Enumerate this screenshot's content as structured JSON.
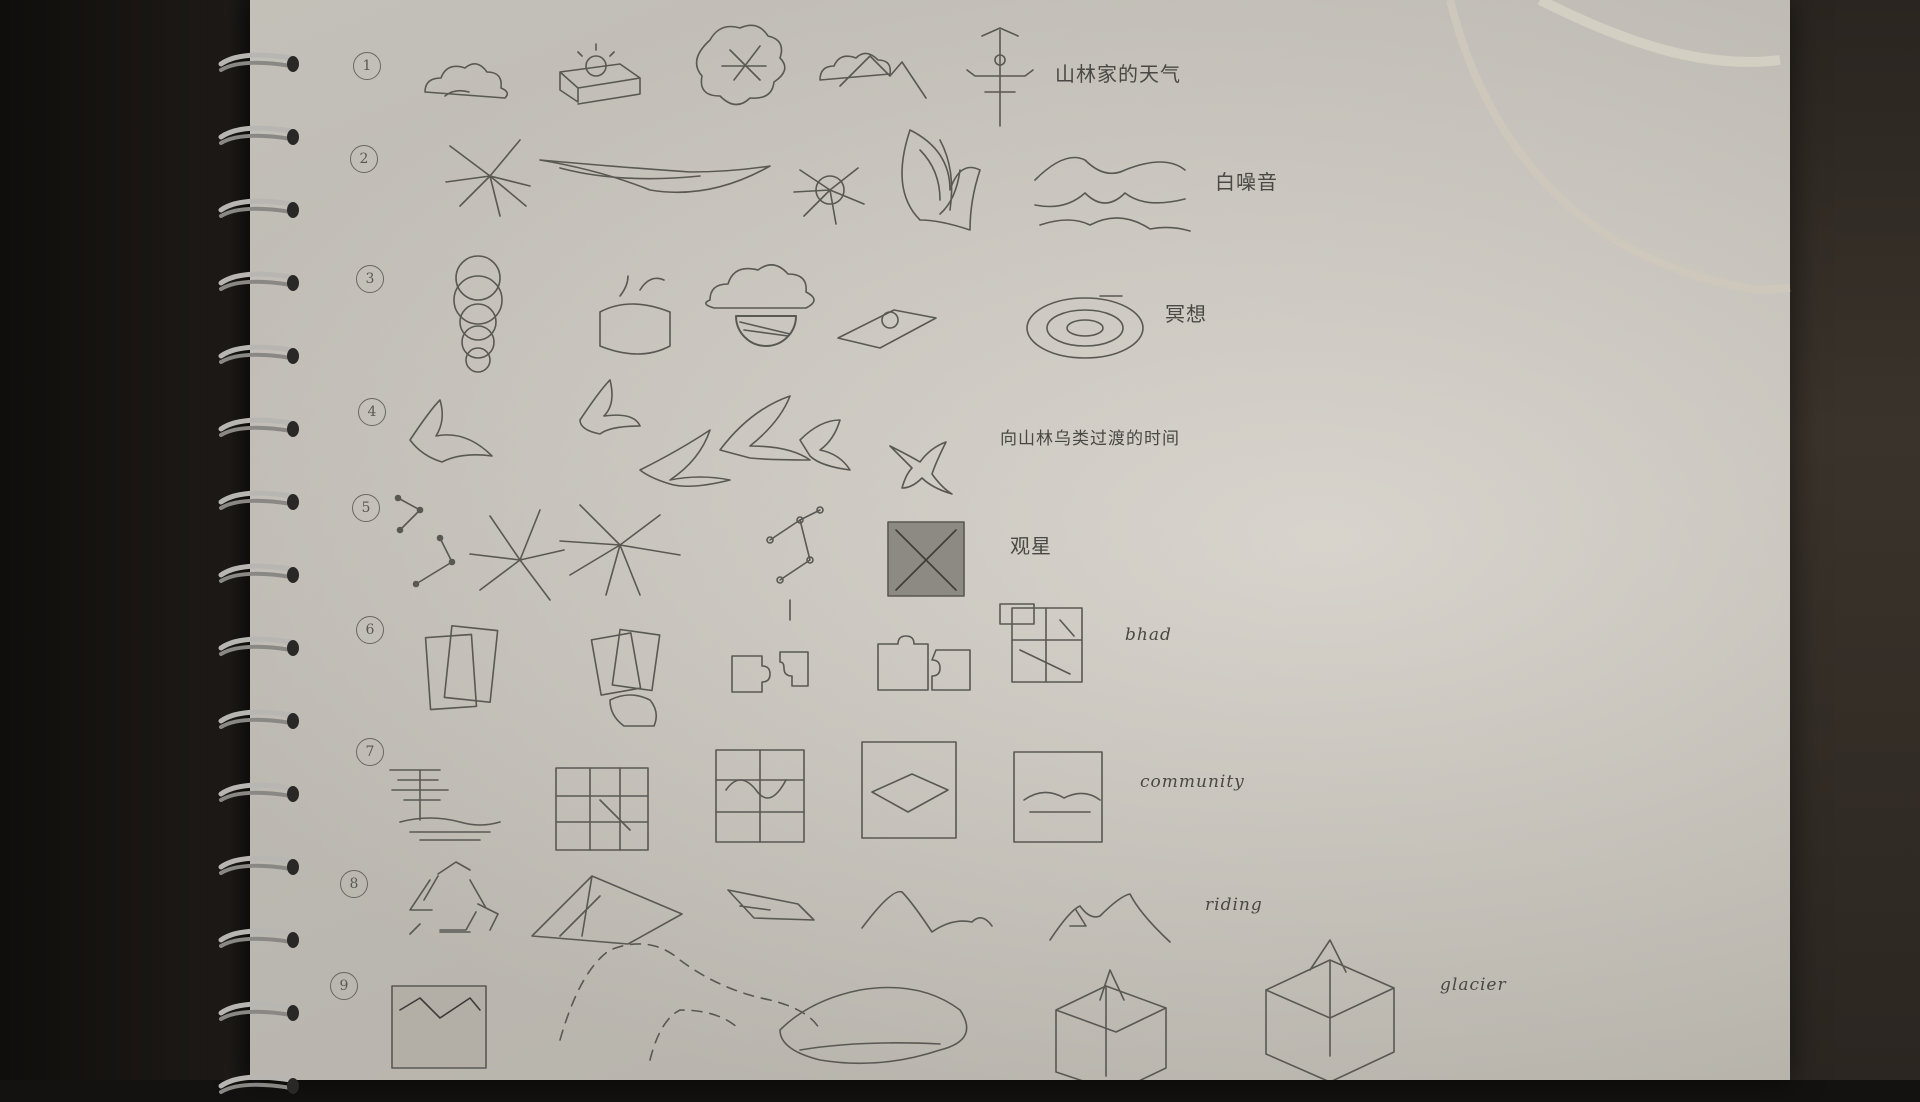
{
  "rows": [
    {
      "number": "1",
      "label": "山林家的天气"
    },
    {
      "number": "2",
      "label": "白噪音"
    },
    {
      "number": "3",
      "label": "冥想"
    },
    {
      "number": "4",
      "label": "向山林乌类过渡的时间"
    },
    {
      "number": "5",
      "label": "观星"
    },
    {
      "number": "6",
      "label": "bhad"
    },
    {
      "number": "7",
      "label": "community"
    },
    {
      "number": "8",
      "label": "riding"
    },
    {
      "number": "9",
      "label": "glacier"
    }
  ],
  "colors": {
    "paper": "#d8d4cc",
    "pencil": "#55534f",
    "background": "#141210"
  }
}
